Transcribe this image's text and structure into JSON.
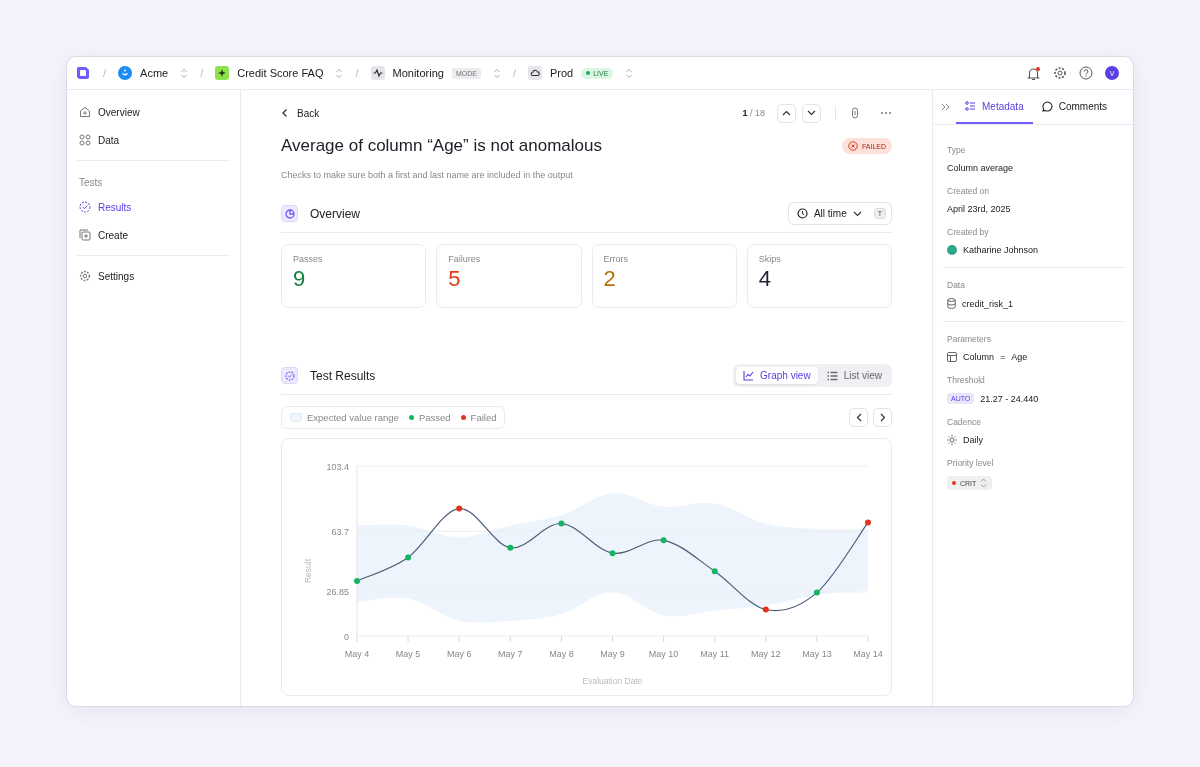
{
  "topbar": {
    "separator": "/",
    "breadcrumbs": [
      {
        "kind": "org",
        "label": "Acme"
      },
      {
        "kind": "project",
        "label": "Credit Score FAQ"
      },
      {
        "kind": "mode",
        "label": "Monitoring",
        "badge": "MODE"
      },
      {
        "kind": "env",
        "label": "Prod",
        "badge": "LIVE"
      }
    ],
    "unread_notifications": true,
    "avatar": "V"
  },
  "sidebar": {
    "groups": [
      {
        "items": [
          {
            "kind": "home",
            "label": "Overview",
            "selected": false
          },
          {
            "kind": "data",
            "label": "Data",
            "selected": false
          }
        ]
      },
      {
        "heading": "Tests",
        "items": [
          {
            "kind": "results",
            "label": "Results",
            "selected": true
          },
          {
            "kind": "create",
            "label": "Create",
            "selected": false
          }
        ]
      },
      {
        "items": [
          {
            "kind": "settings",
            "label": "Settings",
            "selected": false
          }
        ]
      }
    ]
  },
  "header": {
    "back": "Back",
    "pager_current": "1",
    "pager_total": "/ 18",
    "title": "Average of column “Age” is not anomalous",
    "status": "FAILED",
    "description": "Checks to make sure both a first and last name are included in the output"
  },
  "overview": {
    "title": "Overview",
    "range": "All time",
    "shortcut": "T",
    "stats": [
      {
        "label": "Passes",
        "value": "9",
        "color": "#15803d"
      },
      {
        "label": "Failures",
        "value": "5",
        "color": "#e23b13"
      },
      {
        "label": "Errors",
        "value": "2",
        "color": "#b0730a"
      },
      {
        "label": "Skips",
        "value": "4",
        "color": "#1f2433"
      }
    ]
  },
  "test_results": {
    "title": "Test Results",
    "views": [
      {
        "kind": "graph",
        "label": "Graph view",
        "selected": true
      },
      {
        "kind": "list",
        "label": "List view",
        "selected": false
      }
    ],
    "legend": [
      {
        "kind": "range",
        "label": "Expected value range",
        "color": "#eef4fc"
      },
      {
        "kind": "dot",
        "label": "Passed",
        "color": "#16b364"
      },
      {
        "kind": "dot",
        "label": "Failed",
        "color": "#e5341b"
      }
    ],
    "points": [
      {
        "failed": false
      },
      {
        "failed": false
      },
      {
        "failed": true
      },
      {
        "failed": false
      },
      {
        "failed": false
      },
      {
        "failed": false
      },
      {
        "failed": false
      },
      {
        "failed": false
      },
      {
        "failed": true
      },
      {
        "failed": false
      },
      {
        "failed": true
      }
    ],
    "chart_data": {
      "type": "line",
      "xlabel": "Evaluation Date",
      "ylabel": "Result",
      "categories": [
        "May 4",
        "May 5",
        "May 6",
        "May 7",
        "May 8",
        "May 9",
        "May 10",
        "May 11",
        "May 12",
        "May 13",
        "May 14"
      ],
      "series": [
        {
          "color": "#4b5d7a",
          "marker": true,
          "values": [
            33.5,
            47.8,
            77.5,
            53.7,
            68.4,
            50.4,
            58.2,
            39.4,
            16.1,
            26.4,
            69.1
          ]
        }
      ],
      "ylim": [
        0,
        103.4
      ],
      "yticks": [
        0,
        26.85,
        63.7,
        103.4
      ]
    }
  },
  "panel": {
    "tabs": [
      {
        "kind": "metadata",
        "label": "Metadata",
        "selected": true
      },
      {
        "kind": "comments",
        "label": "Comments",
        "selected": false
      }
    ],
    "sections": [
      {
        "fields": [
          {
            "kind": "text",
            "label": "Type",
            "value": "Column average"
          },
          {
            "kind": "text",
            "label": "Created on",
            "value": "April 23rd, 2025"
          },
          {
            "kind": "user",
            "label": "Created by",
            "value": "Katharine Johnson"
          }
        ]
      },
      {
        "fields": [
          {
            "kind": "dataset",
            "label": "Data",
            "value": "credit_risk_1"
          }
        ]
      },
      {
        "fields": [
          {
            "kind": "param",
            "label": "Parameters",
            "name": "Column",
            "operator": "=",
            "value": "Age"
          },
          {
            "kind": "threshold",
            "label": "Threshold",
            "badge": "AUTO",
            "value": "21.27 - 24.440"
          },
          {
            "kind": "cadence",
            "label": "Cadence",
            "value": "Daily"
          },
          {
            "kind": "priority",
            "label": "Priority level",
            "value": "CRIT",
            "color": "#e5341b"
          }
        ]
      }
    ]
  }
}
